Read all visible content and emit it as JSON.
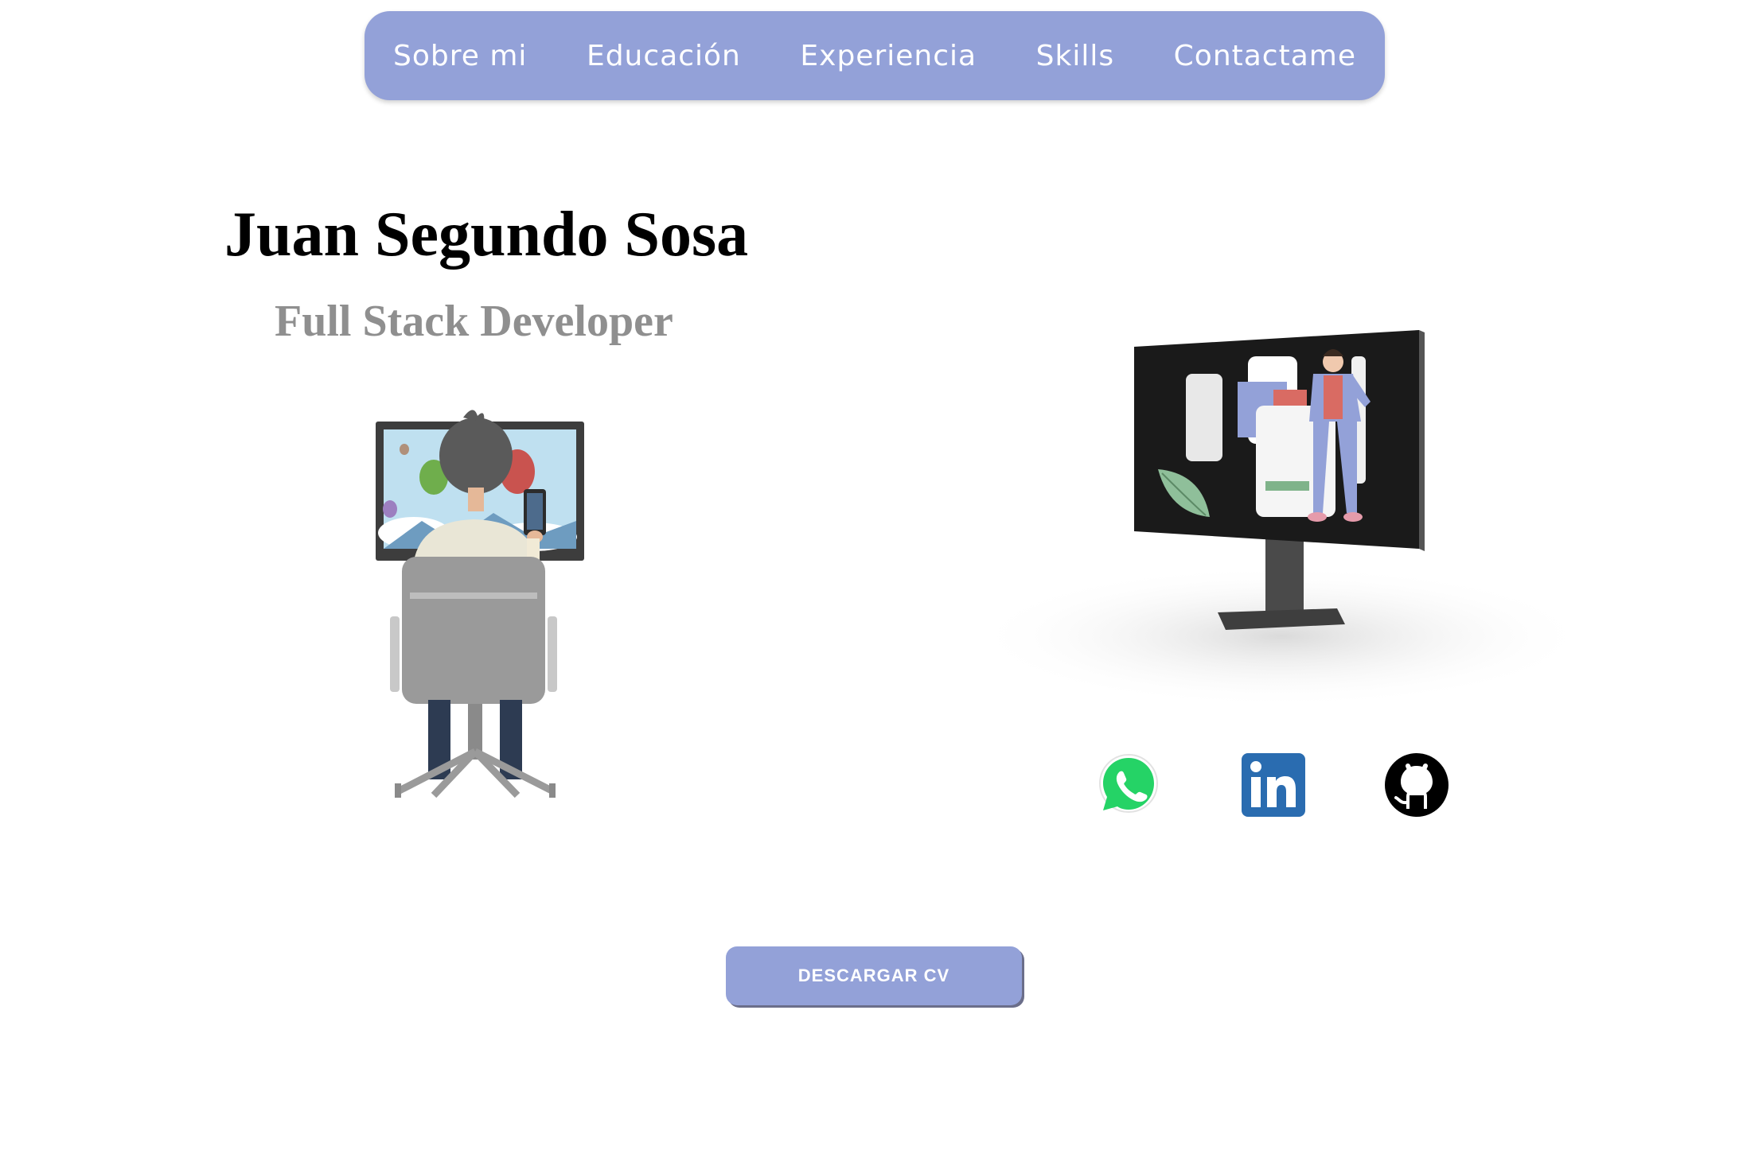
{
  "nav": {
    "items": [
      {
        "label": "Sobre mi"
      },
      {
        "label": "Educación"
      },
      {
        "label": "Experiencia"
      },
      {
        "label": "Skills"
      },
      {
        "label": "Contactame"
      }
    ]
  },
  "hero": {
    "name": "Juan Segundo Sosa",
    "role": "Full Stack Developer"
  },
  "social": {
    "links": [
      {
        "icon": "whatsapp-icon",
        "color": "#25d366"
      },
      {
        "icon": "linkedin-icon",
        "color": "#2a6cb0"
      },
      {
        "icon": "github-icon",
        "color": "#000000"
      }
    ]
  },
  "cv_button": {
    "label": "DESCARGAR CV"
  },
  "colors": {
    "accent": "#93a1d8",
    "text": "#000000",
    "muted": "#8f8f8f"
  }
}
